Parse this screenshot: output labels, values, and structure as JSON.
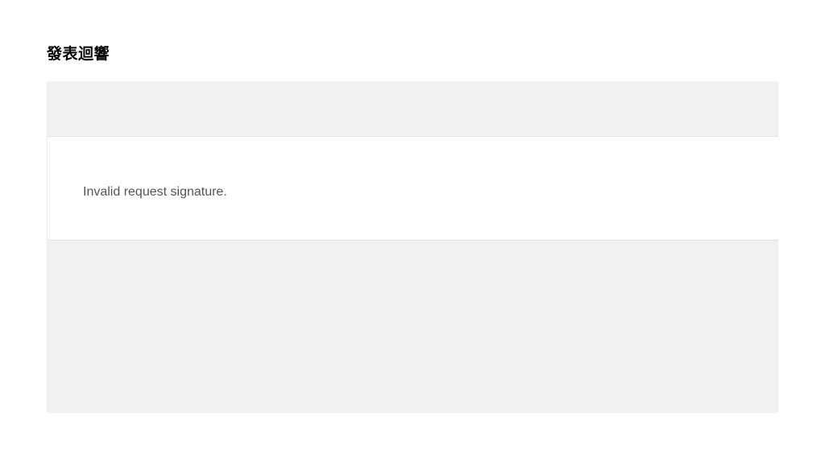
{
  "heading": "發表迴響",
  "message": "Invalid request signature."
}
